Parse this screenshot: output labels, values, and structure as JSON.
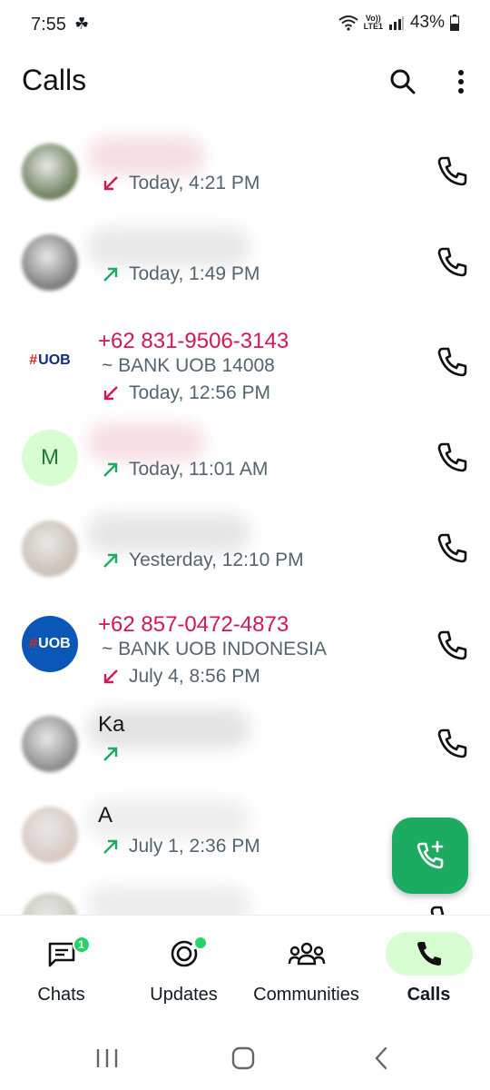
{
  "status": {
    "time": "7:55",
    "net_top": "Vo))",
    "net_bottom": "LTE1",
    "battery": "43%"
  },
  "app_bar": {
    "title": "Calls"
  },
  "calls": [
    {
      "name": "",
      "detail": "Today, 4:21 PM",
      "direction": "incoming-missed"
    },
    {
      "name": "",
      "detail": "Today, 1:49 PM",
      "direction": "outgoing"
    },
    {
      "name": "+62 831-9506-3143",
      "subtitle": "~ BANK UOB 14008",
      "detail": "Today, 12:56 PM",
      "direction": "incoming-missed",
      "avatar_text": "UOB"
    },
    {
      "name": "",
      "detail": "Today, 11:01 AM",
      "direction": "outgoing",
      "avatar_letter": "M"
    },
    {
      "name": "",
      "detail": "Yesterday, 12:10 PM",
      "direction": "outgoing"
    },
    {
      "name": "+62 857-0472-4873",
      "subtitle": "~ BANK UOB INDONESIA",
      "detail": "July 4, 8:56 PM",
      "direction": "incoming-missed",
      "avatar_text": "UOB"
    },
    {
      "name": "Ka",
      "detail": "",
      "direction": "outgoing"
    },
    {
      "name": "A",
      "detail": "July 1, 2:36 PM",
      "direction": "outgoing"
    },
    {
      "name": "",
      "detail": "",
      "direction": "outgoing"
    }
  ],
  "bottom_nav": {
    "items": [
      {
        "label": "Chats",
        "icon": "chat-icon",
        "badge": "1"
      },
      {
        "label": "Updates",
        "icon": "updates-icon"
      },
      {
        "label": "Communities",
        "icon": "communities-icon"
      },
      {
        "label": "Calls",
        "icon": "phone-icon"
      }
    ]
  },
  "colors": {
    "accent": "#1daa61",
    "missed": "#d1184f",
    "active_nav": "#d8fdd2"
  }
}
